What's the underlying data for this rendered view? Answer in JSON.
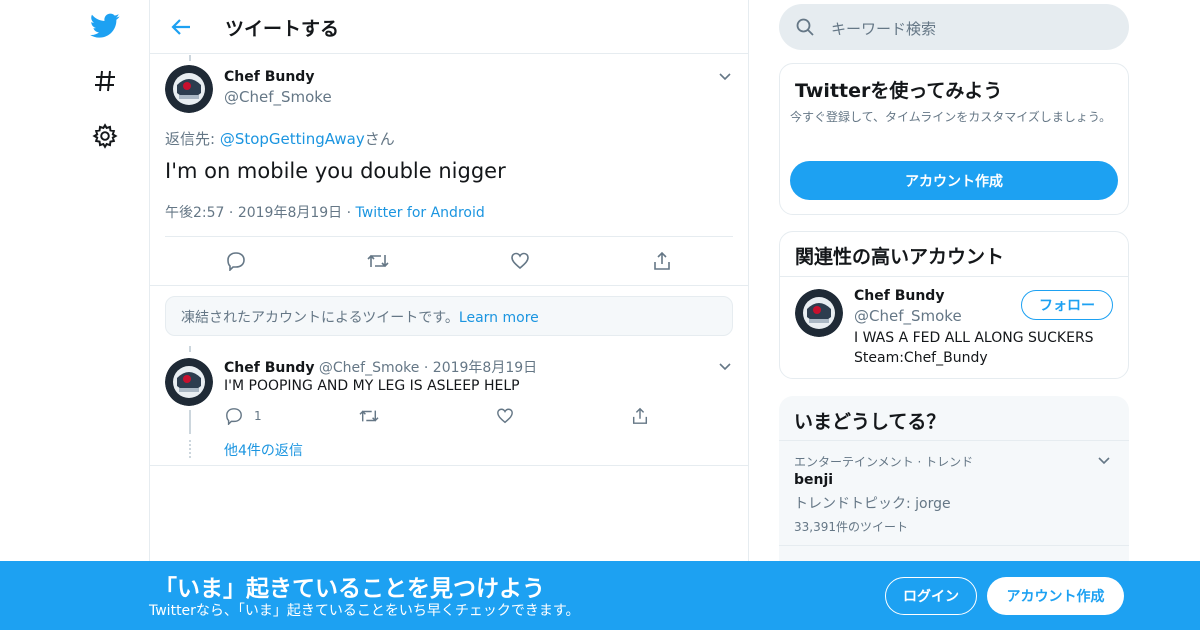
{
  "colors": {
    "accent": "#1da1f2",
    "link": "#1b95e0",
    "muted": "#657786",
    "border": "#e6ecf0"
  },
  "nav": {
    "icons": [
      "twitter-logo-icon",
      "hashtag-icon",
      "gear-icon"
    ]
  },
  "header": {
    "title": "ツイートする"
  },
  "main_tweet": {
    "name": "Chef Bundy",
    "handle": "@Chef_Smoke",
    "reply_prefix": "返信先: ",
    "reply_to": "@StopGettingAway",
    "reply_suffix": "さん",
    "text": "I'm on mobile you double nigger",
    "time": "午後2:57",
    "date": "2019年8月19日",
    "source": "Twitter for Android"
  },
  "notice": {
    "text": "凍結されたアカウントによるツイートです。",
    "link": "Learn more"
  },
  "reply_tweet": {
    "name": "Chef Bundy",
    "handle": "@Chef_Smoke",
    "date": "2019年8月19日",
    "text": "I'M POOPING AND MY LEG IS ASLEEP HELP",
    "reply_count": "1",
    "more_replies": "他4件の返信"
  },
  "search": {
    "placeholder": "キーワード検索"
  },
  "signup_card": {
    "title": "Twitterを使ってみよう",
    "subtitle": "今すぐ登録して、タイムラインをカスタマイズしましょう。",
    "button": "アカウント作成"
  },
  "related_card": {
    "title": "関連性の高いアカウント",
    "name": "Chef Bundy",
    "handle": "@Chef_Smoke",
    "follow": "フォロー",
    "bio_line1": "I WAS A FED ALL ALONG SUCKERS",
    "bio_line2": "Steam:Chef_Bundy"
  },
  "trends_card": {
    "title": "いまどうしてる？",
    "category": "エンターテインメント · トレンド",
    "name": "benji",
    "topic": "トレンドトピック: jorge",
    "count": "33,391件のツイート"
  },
  "banner": {
    "title": "「いま」起きていることを見つけよう",
    "subtitle": "Twitterなら、「いま」起きていることをいち早くチェックできます。",
    "login": "ログイン",
    "signup": "アカウント作成"
  }
}
